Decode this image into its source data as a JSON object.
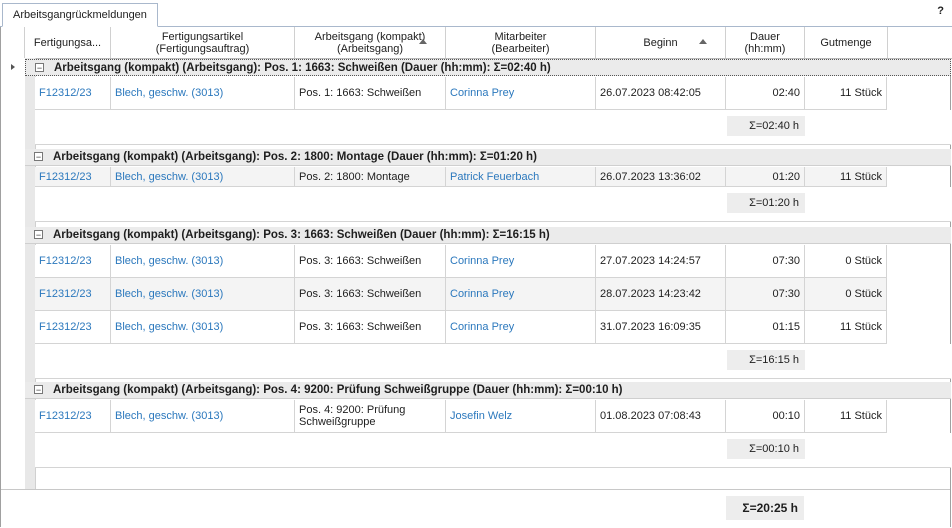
{
  "tab": {
    "label": "Arbeitsgangrückmeldungen",
    "help": "?"
  },
  "columns": [
    {
      "label": "Fertigungsa..."
    },
    {
      "label": "Fertigungsartikel\n(Fertigungsauftrag)"
    },
    {
      "label": "Arbeitsgang (kompakt)\n(Arbeitsgang)"
    },
    {
      "label": "Mitarbeiter\n(Bearbeiter)"
    },
    {
      "label": "Beginn"
    },
    {
      "label": "Dauer\n(hh:mm)"
    },
    {
      "label": "Gutmenge"
    }
  ],
  "groups": [
    {
      "title": "Arbeitsgang (kompakt) (Arbeitsgang): Pos. 1: 1663: Schweißen (Dauer (hh:mm): Σ=02:40 h)",
      "rows": [
        {
          "order": "F12312/23",
          "article": "Blech, geschw. (3013)",
          "step": "Pos. 1: 1663: Schweißen",
          "employee": "Corinna Prey",
          "start": "26.07.2023 08:42:05",
          "duration": "02:40",
          "qty": "11 Stück"
        }
      ],
      "sum": "Σ=02:40 h"
    },
    {
      "title": "Arbeitsgang (kompakt) (Arbeitsgang): Pos. 2: 1800: Montage (Dauer (hh:mm): Σ=01:20 h)",
      "rows": [
        {
          "order": "F12312/23",
          "article": "Blech, geschw. (3013)",
          "step": "Pos. 2: 1800: Montage",
          "employee": "Patrick Feuerbach",
          "start": "26.07.2023 13:36:02",
          "duration": "01:20",
          "qty": "11 Stück"
        }
      ],
      "sum": "Σ=01:20 h"
    },
    {
      "title": "Arbeitsgang (kompakt) (Arbeitsgang): Pos. 3: 1663: Schweißen (Dauer (hh:mm): Σ=16:15 h)",
      "rows": [
        {
          "order": "F12312/23",
          "article": "Blech, geschw. (3013)",
          "step": "Pos. 3: 1663: Schweißen",
          "employee": "Corinna Prey",
          "start": "27.07.2023 14:24:57",
          "duration": "07:30",
          "qty": "0 Stück"
        },
        {
          "order": "F12312/23",
          "article": "Blech, geschw. (3013)",
          "step": "Pos. 3: 1663: Schweißen",
          "employee": "Corinna Prey",
          "start": "28.07.2023 14:23:42",
          "duration": "07:30",
          "qty": "0 Stück"
        },
        {
          "order": "F12312/23",
          "article": "Blech, geschw. (3013)",
          "step": "Pos. 3: 1663: Schweißen",
          "employee": "Corinna Prey",
          "start": "31.07.2023 16:09:35",
          "duration": "01:15",
          "qty": "11 Stück"
        }
      ],
      "sum": "Σ=16:15 h"
    },
    {
      "title": "Arbeitsgang (kompakt) (Arbeitsgang): Pos. 4: 9200: Prüfung Schweißgruppe (Dauer (hh:mm): Σ=00:10 h)",
      "rows": [
        {
          "order": "F12312/23",
          "article": "Blech, geschw. (3013)",
          "step": "Pos. 4: 9200: Prüfung Schweißgruppe",
          "employee": "Josefin Welz",
          "start": "01.08.2023 07:08:43",
          "duration": "00:10",
          "qty": "11 Stück"
        }
      ],
      "sum": "Σ=00:10 h"
    }
  ],
  "total": "Σ=20:25 h",
  "toggle_symbol": "−"
}
